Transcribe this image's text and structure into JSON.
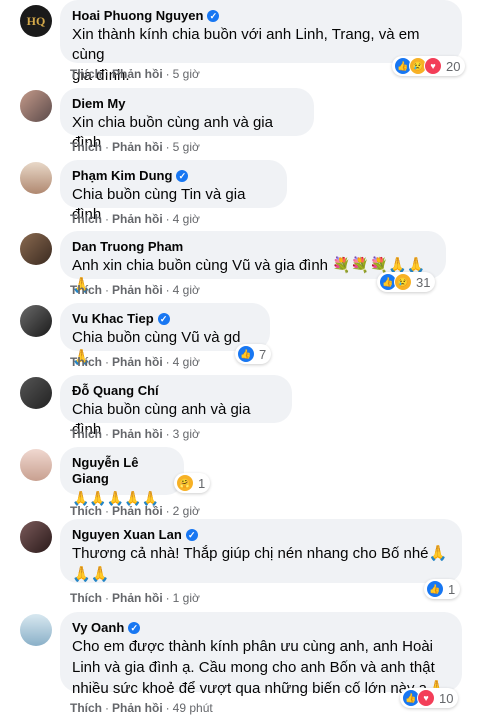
{
  "labels": {
    "like": "Thích",
    "reply": "Phản hồi",
    "sep": "·"
  },
  "comments": [
    {
      "author": "Hoai Phuong Nguyen",
      "text1": "Xin thành kính chia buồn với anh Linh, Trang, và em cùng",
      "text2": "gia đình.",
      "time": "5 giờ",
      "reactions": "20",
      "reaction_icons": [
        "like-icon",
        "sad-icon",
        "love-icon"
      ]
    },
    {
      "author": "Diem My",
      "text1": "Xin chia buồn cùng anh và gia đình",
      "time": "5 giờ"
    },
    {
      "author": "Phạm Kim Dung",
      "text1": "Chia buồn cùng Tin và gia đình",
      "time": "4 giờ"
    },
    {
      "author": "Dan Truong Pham",
      "text1": "Anh xin chia buồn cùng Vũ và gia đình 💐💐💐🙏🙏🙏",
      "time": "4 giờ",
      "reactions": "31",
      "reaction_icons": [
        "like-icon",
        "sad-icon"
      ]
    },
    {
      "author": "Vu Khac Tiep",
      "text1": "Chia buồn cùng Vũ và gd 🙏",
      "time": "4 giờ",
      "reactions": "7",
      "reaction_icons": [
        "like-icon"
      ]
    },
    {
      "author": "Đỗ Quang Chí",
      "text1": "Chia buồn cùng anh và gia đình",
      "time": "3 giờ"
    },
    {
      "author": "Nguyễn Lê Giang",
      "text1": "🙏🙏🙏🙏🙏",
      "time": "2 giờ",
      "reactions": "1",
      "reaction_icons": [
        "care-icon"
      ]
    },
    {
      "author": "Nguyen Xuan Lan",
      "text1": "Thương cả nhà! Thắp giúp chị nén nhang cho Bố nhé🙏",
      "text2": "🙏🙏",
      "time": "1 giờ",
      "reactions": "1",
      "reaction_icons": [
        "like-icon"
      ]
    },
    {
      "author": "Vy Oanh",
      "text1": "Cho em được thành kính phân ưu cùng anh, anh Hoài",
      "text2": "Linh và gia đình ạ. Cầu mong cho anh Bốn và anh thật",
      "text3": "nhiều sức khoẻ để vượt qua những biến cố lớn này ạ🙏",
      "time": "49 phút",
      "reactions": "10",
      "reaction_icons": [
        "like-icon",
        "love-icon"
      ]
    }
  ],
  "colors": {
    "bubble": "#f0f2f5",
    "link": "#65676b",
    "verified": "#1877f2"
  }
}
